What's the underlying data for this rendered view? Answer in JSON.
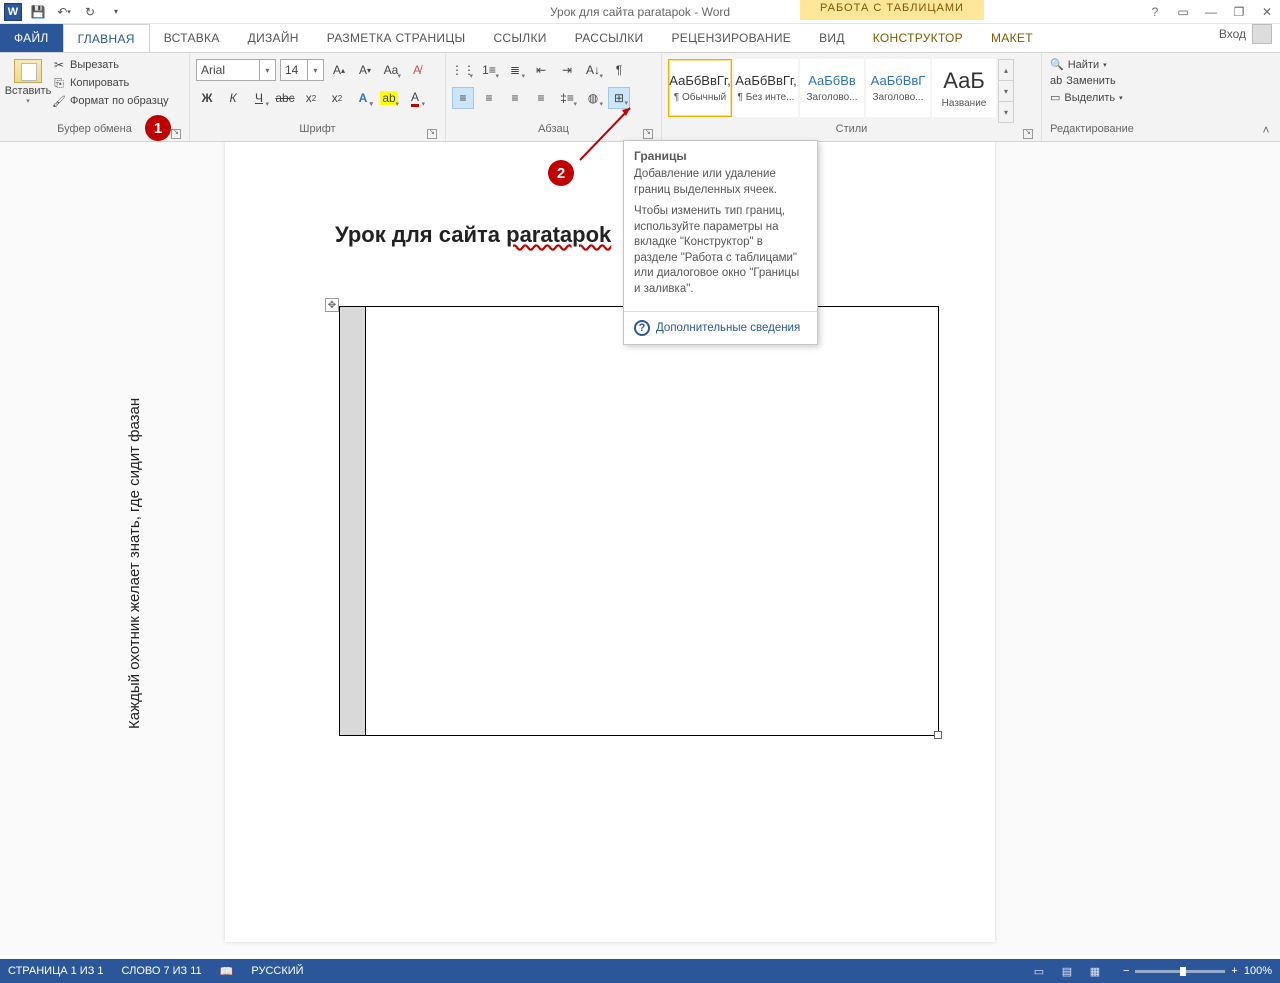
{
  "app": {
    "title": "Урок для сайта paratapok - Word",
    "table_tools": "РАБОТА С ТАБЛИЦАМИ",
    "login": "Вход"
  },
  "tabs": {
    "file": "ФАЙЛ",
    "home": "ГЛАВНАЯ",
    "insert": "ВСТАВКА",
    "design": "ДИЗАЙН",
    "layout": "РАЗМЕТКА СТРАНИЦЫ",
    "refs": "ССЫЛКИ",
    "mail": "РАССЫЛКИ",
    "review": "РЕЦЕНЗИРОВАНИЕ",
    "view": "ВИД",
    "constructor": "КОНСТРУКТОР",
    "maket": "МАКЕТ"
  },
  "clipboard": {
    "group": "Буфер обмена",
    "paste": "Вставить",
    "cut": "Вырезать",
    "copy": "Копировать",
    "format_painter": "Формат по образцу"
  },
  "font": {
    "group": "Шрифт",
    "name": "Arial",
    "size": "14",
    "bold": "Ж",
    "italic": "К",
    "underline": "Ч",
    "strike": "abc",
    "sub": "x",
    "sup": "x"
  },
  "para": {
    "group": "Абзац"
  },
  "styles": {
    "group": "Стили",
    "items": [
      {
        "preview": "АаБбВвГг,",
        "name": "¶ Обычный",
        "color": "#333"
      },
      {
        "preview": "АаБбВвГг,",
        "name": "¶ Без инте...",
        "color": "#333"
      },
      {
        "preview": "АаБбВв",
        "name": "Заголово...",
        "color": "#2e74b5"
      },
      {
        "preview": "АаБбВвГ",
        "name": "Заголово...",
        "color": "#2e74b5"
      },
      {
        "preview": "АаБ",
        "name": "Название",
        "color": "#333"
      }
    ]
  },
  "editing": {
    "group": "Редактирование",
    "find": "Найти",
    "replace": "Заменить",
    "select": "Выделить"
  },
  "badges": {
    "one": "1",
    "two": "2"
  },
  "tooltip": {
    "title": "Границы",
    "p1": "Добавление или удаление границ выделенных ячеек.",
    "p2": "Чтобы изменить тип границ, используйте параметры на вкладке \"Конструктор\" в разделе \"Работа с таблицами\" или диалоговое окно \"Границы и заливка\".",
    "more": "Дополнительные сведения"
  },
  "doc": {
    "title_pre": "Урок для сайта ",
    "title_link": "paratapok",
    "cell_text": "Каждый охотник желает  знать, где сидит фазан"
  },
  "status": {
    "page": "СТРАНИЦА 1 ИЗ 1",
    "words": "СЛОВО 7 ИЗ 11",
    "lang": "РУССКИЙ",
    "zoom": "100%"
  }
}
